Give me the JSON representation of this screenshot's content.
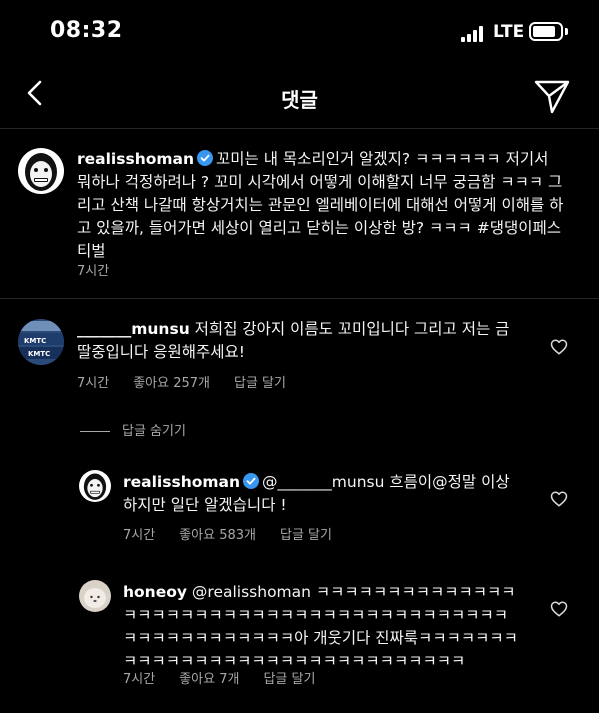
{
  "status_bar": {
    "time": "08:32",
    "network": "LTE"
  },
  "nav": {
    "title": "댓글"
  },
  "caption": {
    "username": "realisshoman",
    "text": "꼬미는 내 목소리인거 알겠지? ㅋㅋㅋㅋㅋㅋ 저기서 뭐하나 걱정하려나 ? 꼬미 시각에서 어떻게 이해할지 너무 궁금함 ㅋㅋㅋ 그리고 산책 나갈때 항상거치는 관문인 엘레베이터에 대해선 어떻게 이해를 하고 있을까, 들어가면 세상이 열리고 닫히는 이상한 방?  ㅋㅋㅋ #댕댕이페스티벌",
    "time": "7시간"
  },
  "comments": [
    {
      "username": "_______munsu",
      "text": "저희집 강아지 이름도 꼬미입니다 그리고 저는 금딸중입니다 응원해주세요!",
      "time": "7시간",
      "likes": "좋아요 257개",
      "reply": "답글 달기"
    }
  ],
  "hide_replies_label": "답글 숨기기",
  "replies": [
    {
      "username": "realisshoman",
      "text": "@_______munsu 흐름이@정말 이상하지만 일단 알겠습니다 !",
      "time": "7시간",
      "likes": "좋아요 583개",
      "reply": "답글 달기"
    },
    {
      "username": "honeoy",
      "text": "@realisshoman ㅋㅋㅋㅋㅋㅋㅋㅋㅋㅋㅋㅋㅋㅋㅋㅋㅋㅋㅋㅋㅋㅋㅋㅋㅋㅋㅋㅋㅋㅋㅋㅋㅋㅋㅋㅋㅋㅋㅋㅋㅋㅋㅋㅋㅋㅋㅋㅋㅋㅋㅋㅋㅋ아 개웃기다 진짜룩ㅋㅋㅋㅋㅋㅋㅋㅋㅋㅋㅋㅋㅋㅋㅋㅋㅋㅋㅋㅋㅋㅋㅋㅋㅋㅋㅋㅋㅋㅋㅋ",
      "time": "7시간",
      "likes": "좋아요 7개",
      "reply": "답글 달기"
    }
  ],
  "colors": {
    "background": "#000000",
    "meta": "#a8a8a8",
    "verified": "#3897f0",
    "divider": "#262626"
  },
  "icons": [
    "back-icon",
    "send-icon",
    "verified-badge-icon",
    "heart-icon",
    "signal-icon",
    "battery-icon"
  ]
}
